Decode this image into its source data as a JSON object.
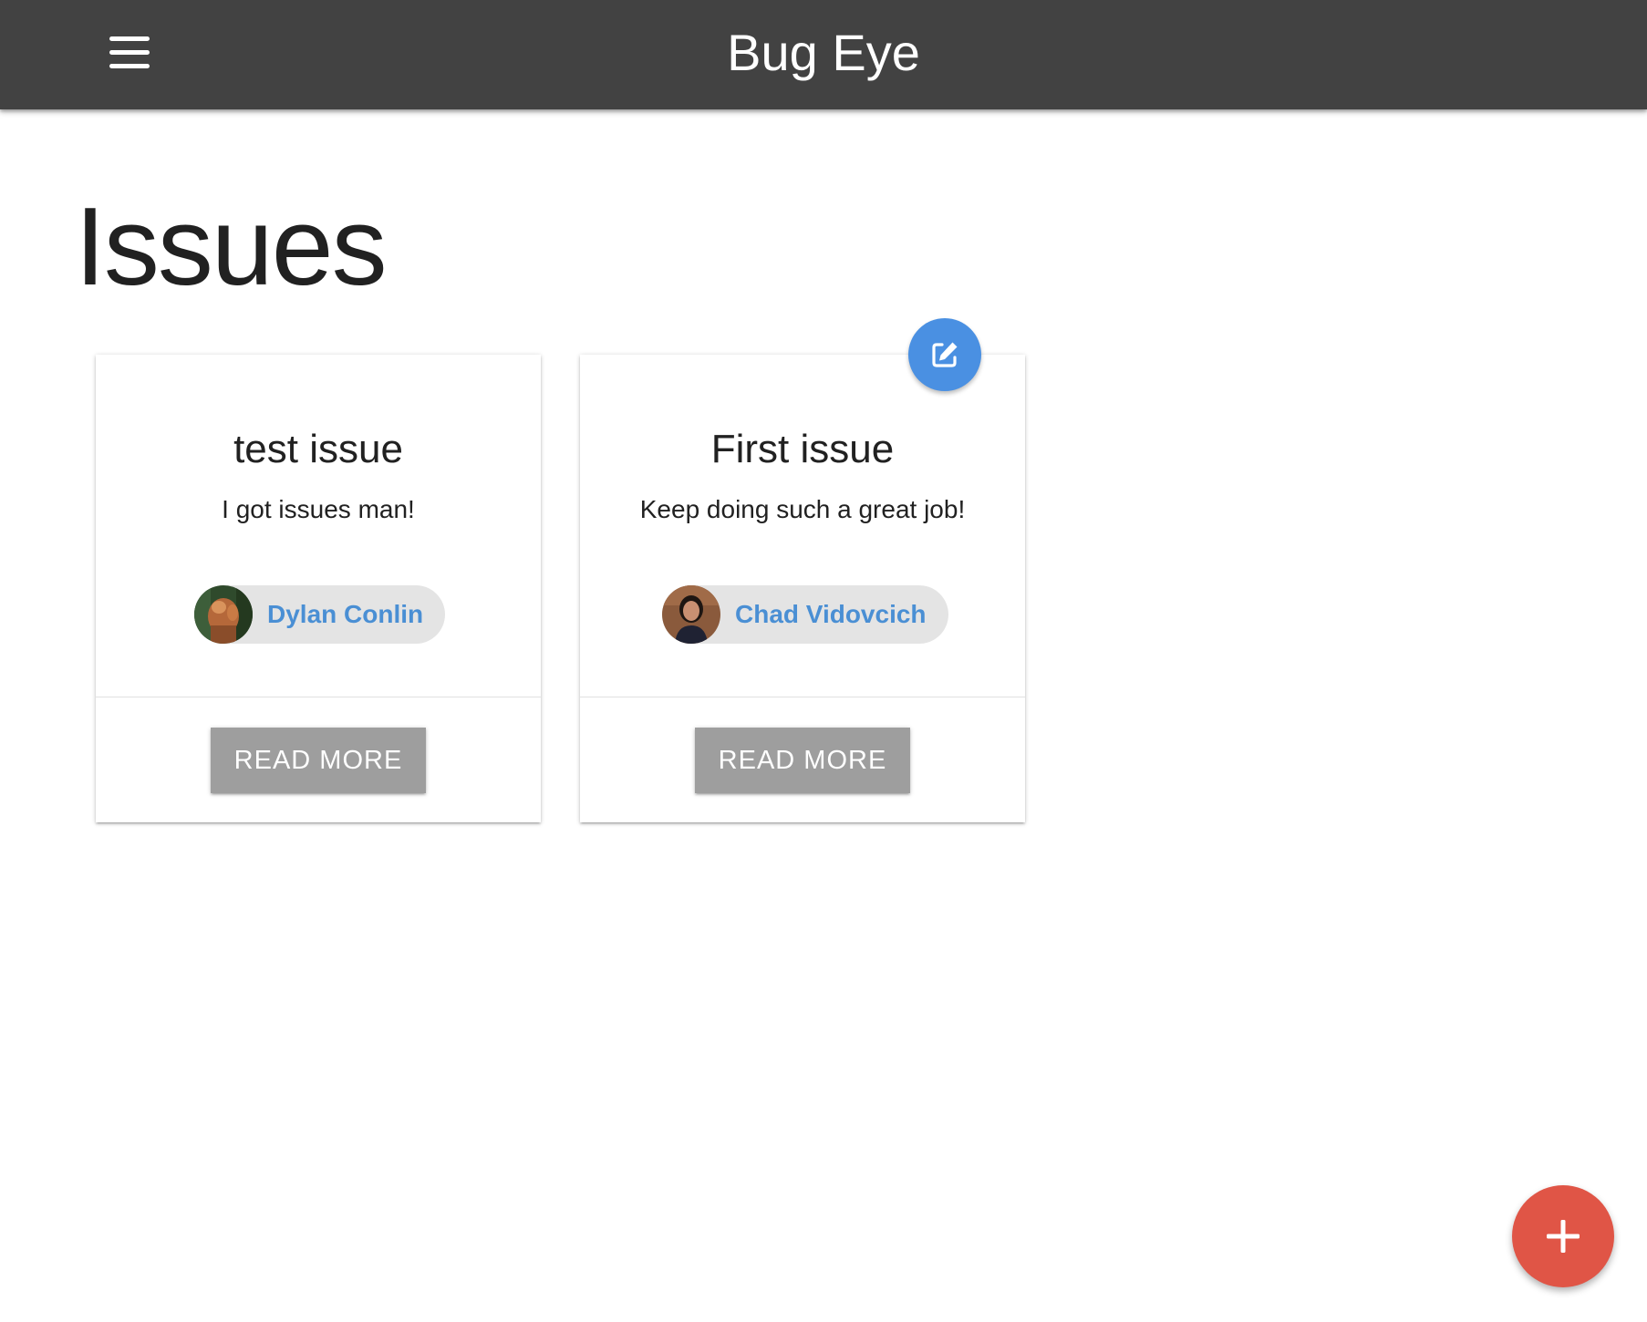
{
  "app": {
    "title": "Bug Eye",
    "menu_icon": "hamburger-menu-icon"
  },
  "page": {
    "heading": "Issues"
  },
  "issues": [
    {
      "title": "test issue",
      "description": "I got issues man!",
      "assignee": "Dylan Conlin",
      "action_label": "READ MORE"
    },
    {
      "title": "First issue",
      "description": "Keep doing such a great job!",
      "assignee": "Chad Vidovcich",
      "action_label": "READ MORE"
    }
  ],
  "fabs": {
    "edit_icon": "edit-icon",
    "add_icon": "plus-icon"
  },
  "colors": {
    "navbar": "#424242",
    "chip_name": "#4a8fd4",
    "edit_fab": "#4a90e2",
    "add_fab": "#e05546",
    "button": "#9e9e9e"
  }
}
